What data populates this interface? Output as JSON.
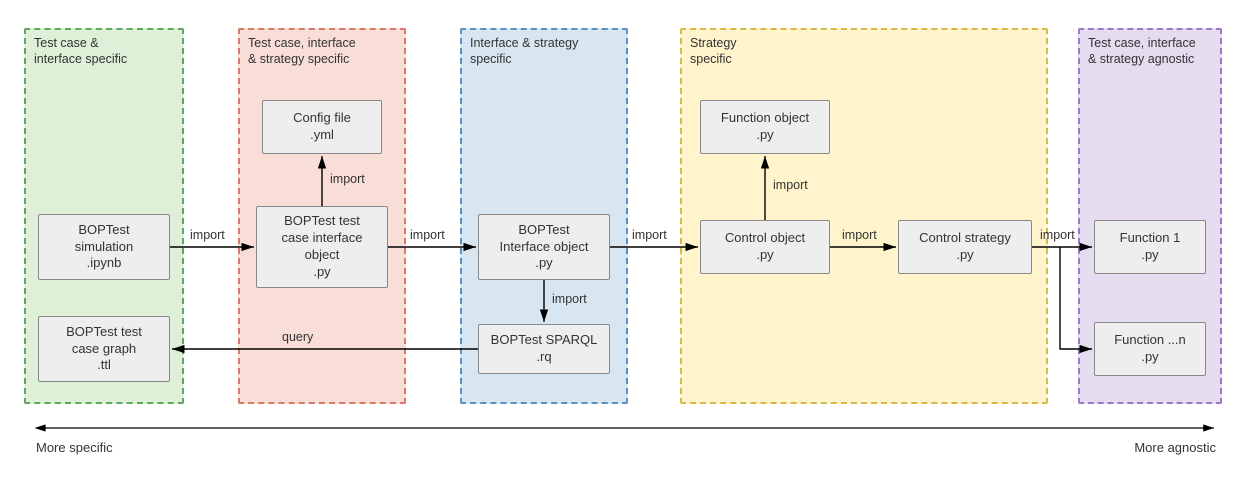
{
  "zones": {
    "z1": {
      "title": "Test case &\ninterface specific",
      "bg": "#dff0d8",
      "border": "#5ea85e"
    },
    "z2": {
      "title": "Test case, interface\n& strategy specific",
      "bg": "#f9ded8",
      "border": "#d9796a"
    },
    "z3": {
      "title": "Interface & strategy\nspecific",
      "bg": "#d7e6f0",
      "border": "#5a8fbf"
    },
    "z4": {
      "title": "Strategy\nspecific",
      "bg": "#fff4cc",
      "border": "#d4b84a"
    },
    "z5": {
      "title": "Test case, interface\n& strategy agnostic",
      "bg": "#e5dcf0",
      "border": "#9a78c8"
    }
  },
  "nodes": {
    "n_sim": {
      "line1": "BOPTest",
      "line2": "simulation",
      "line3": ".ipynb"
    },
    "n_graph": {
      "line1": "BOPTest test",
      "line2": "case graph",
      "line3": ".ttl"
    },
    "n_config": {
      "line1": "Config file",
      "line2": ".yml"
    },
    "n_tcif": {
      "line1": "BOPTest test",
      "line2": "case interface",
      "line3": "object",
      "line4": ".py"
    },
    "n_ifobj": {
      "line1": "BOPTest",
      "line2": "Interface object",
      "line3": ".py"
    },
    "n_sparql": {
      "line1": "BOPTest SPARQL",
      "line2": ".rq"
    },
    "n_funobj": {
      "line1": "Function object",
      "line2": ".py"
    },
    "n_ctrlobj": {
      "line1": "Control object",
      "line2": ".py"
    },
    "n_ctrlstr": {
      "line1": "Control strategy",
      "line2": ".py"
    },
    "n_fn1": {
      "line1": "Function 1",
      "line2": ".py"
    },
    "n_fnn": {
      "line1": "Function ...n",
      "line2": ".py"
    }
  },
  "edges": {
    "import": "import",
    "query": "query"
  },
  "axis": {
    "left": "More specific",
    "right": "More agnostic"
  }
}
